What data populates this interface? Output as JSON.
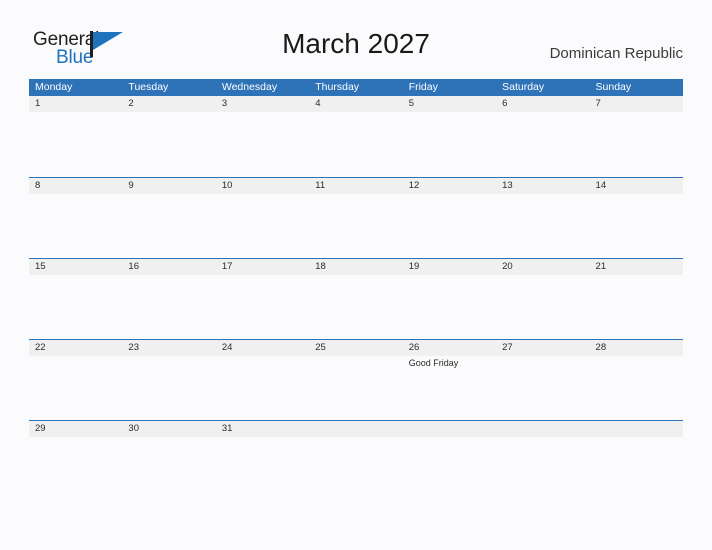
{
  "brand": {
    "name_top": "General",
    "name_bottom": "Blue",
    "flag_icon": "flag-icon",
    "accent_color": "#1f72bb"
  },
  "header": {
    "title": "March 2027",
    "country": "Dominican Republic"
  },
  "calendar": {
    "header_bg": "#2e72b8",
    "date_strip_bg": "#f0f0f0",
    "weekday_headers": [
      "Monday",
      "Tuesday",
      "Wednesday",
      "Thursday",
      "Friday",
      "Saturday",
      "Sunday"
    ],
    "weeks": [
      {
        "days": [
          {
            "date": "1",
            "events": []
          },
          {
            "date": "2",
            "events": []
          },
          {
            "date": "3",
            "events": []
          },
          {
            "date": "4",
            "events": []
          },
          {
            "date": "5",
            "events": []
          },
          {
            "date": "6",
            "events": []
          },
          {
            "date": "7",
            "events": []
          }
        ]
      },
      {
        "days": [
          {
            "date": "8",
            "events": []
          },
          {
            "date": "9",
            "events": []
          },
          {
            "date": "10",
            "events": []
          },
          {
            "date": "11",
            "events": []
          },
          {
            "date": "12",
            "events": []
          },
          {
            "date": "13",
            "events": []
          },
          {
            "date": "14",
            "events": []
          }
        ]
      },
      {
        "days": [
          {
            "date": "15",
            "events": []
          },
          {
            "date": "16",
            "events": []
          },
          {
            "date": "17",
            "events": []
          },
          {
            "date": "18",
            "events": []
          },
          {
            "date": "19",
            "events": []
          },
          {
            "date": "20",
            "events": []
          },
          {
            "date": "21",
            "events": []
          }
        ]
      },
      {
        "days": [
          {
            "date": "22",
            "events": []
          },
          {
            "date": "23",
            "events": []
          },
          {
            "date": "24",
            "events": []
          },
          {
            "date": "25",
            "events": []
          },
          {
            "date": "26",
            "events": [
              "Good Friday"
            ]
          },
          {
            "date": "27",
            "events": []
          },
          {
            "date": "28",
            "events": []
          }
        ]
      },
      {
        "days": [
          {
            "date": "29",
            "events": []
          },
          {
            "date": "30",
            "events": []
          },
          {
            "date": "31",
            "events": []
          },
          {
            "date": "",
            "events": []
          },
          {
            "date": "",
            "events": []
          },
          {
            "date": "",
            "events": []
          },
          {
            "date": "",
            "events": []
          }
        ]
      }
    ]
  }
}
